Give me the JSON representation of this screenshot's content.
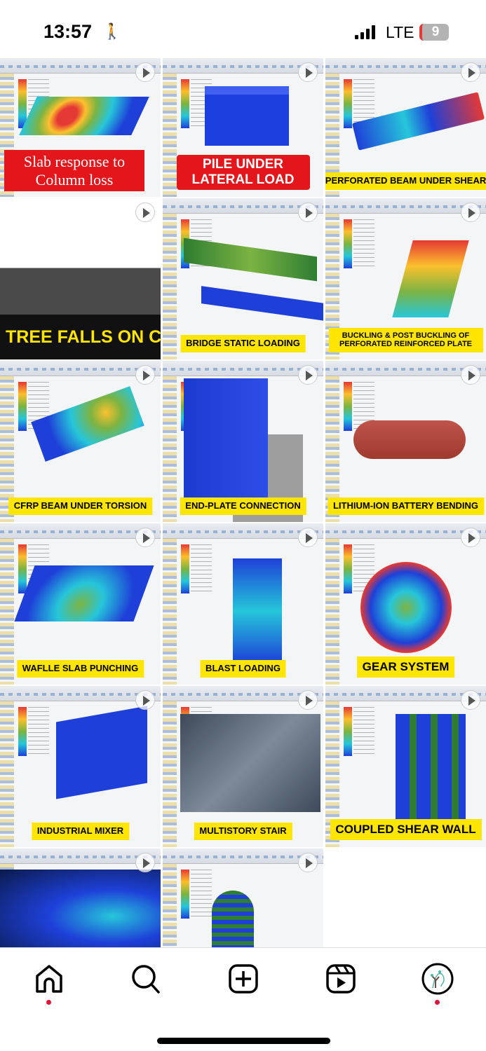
{
  "status_bar": {
    "time": "13:57",
    "network": "LTE",
    "battery": "9"
  },
  "grid": {
    "posts": [
      {
        "caption": "Slab response to Column loss",
        "style": "red"
      },
      {
        "caption": "PILE UNDER LATERAL LOAD",
        "style": "red2"
      },
      {
        "caption": "PERFORATED BEAM UNDER SHEAR",
        "style": "yellow"
      },
      {
        "caption": "TREE FALLS ON CAR",
        "style": "dark"
      },
      {
        "caption": "BRIDGE STATIC LOADING",
        "style": "yellow"
      },
      {
        "caption": "BUCKLING & POST BUCKLING OF PERFORATED REINFORCED PLATE",
        "style": "yellow"
      },
      {
        "caption": "CFRP BEAM UNDER TORSION",
        "style": "yellow"
      },
      {
        "caption": "END-PLATE CONNECTION",
        "style": "yellow"
      },
      {
        "caption": "LITHIUM-ION BATTERY BENDING",
        "style": "yellow"
      },
      {
        "caption": "WAFLLE SLAB PUNCHING",
        "style": "yellow"
      },
      {
        "caption": "BLAST LOADING",
        "style": "yellow"
      },
      {
        "caption": "GEAR SYSTEM",
        "style": "yellow"
      },
      {
        "caption": "INDUSTRIAL MIXER",
        "style": "yellow"
      },
      {
        "caption": "MULTISTORY STAIR",
        "style": "yellow"
      },
      {
        "caption": "COUPLED SHEAR WALL",
        "style": "yellow"
      },
      {
        "caption": "",
        "style": "none"
      },
      {
        "caption": "",
        "style": "none"
      }
    ]
  },
  "bottom_nav": {
    "items": [
      "home-icon",
      "search-icon",
      "create-icon",
      "reels-icon",
      "profile-avatar"
    ]
  },
  "colors": {
    "notification_dot": "#e0153a",
    "caption_yellow": "#ffe500",
    "caption_red": "#e3161b"
  }
}
